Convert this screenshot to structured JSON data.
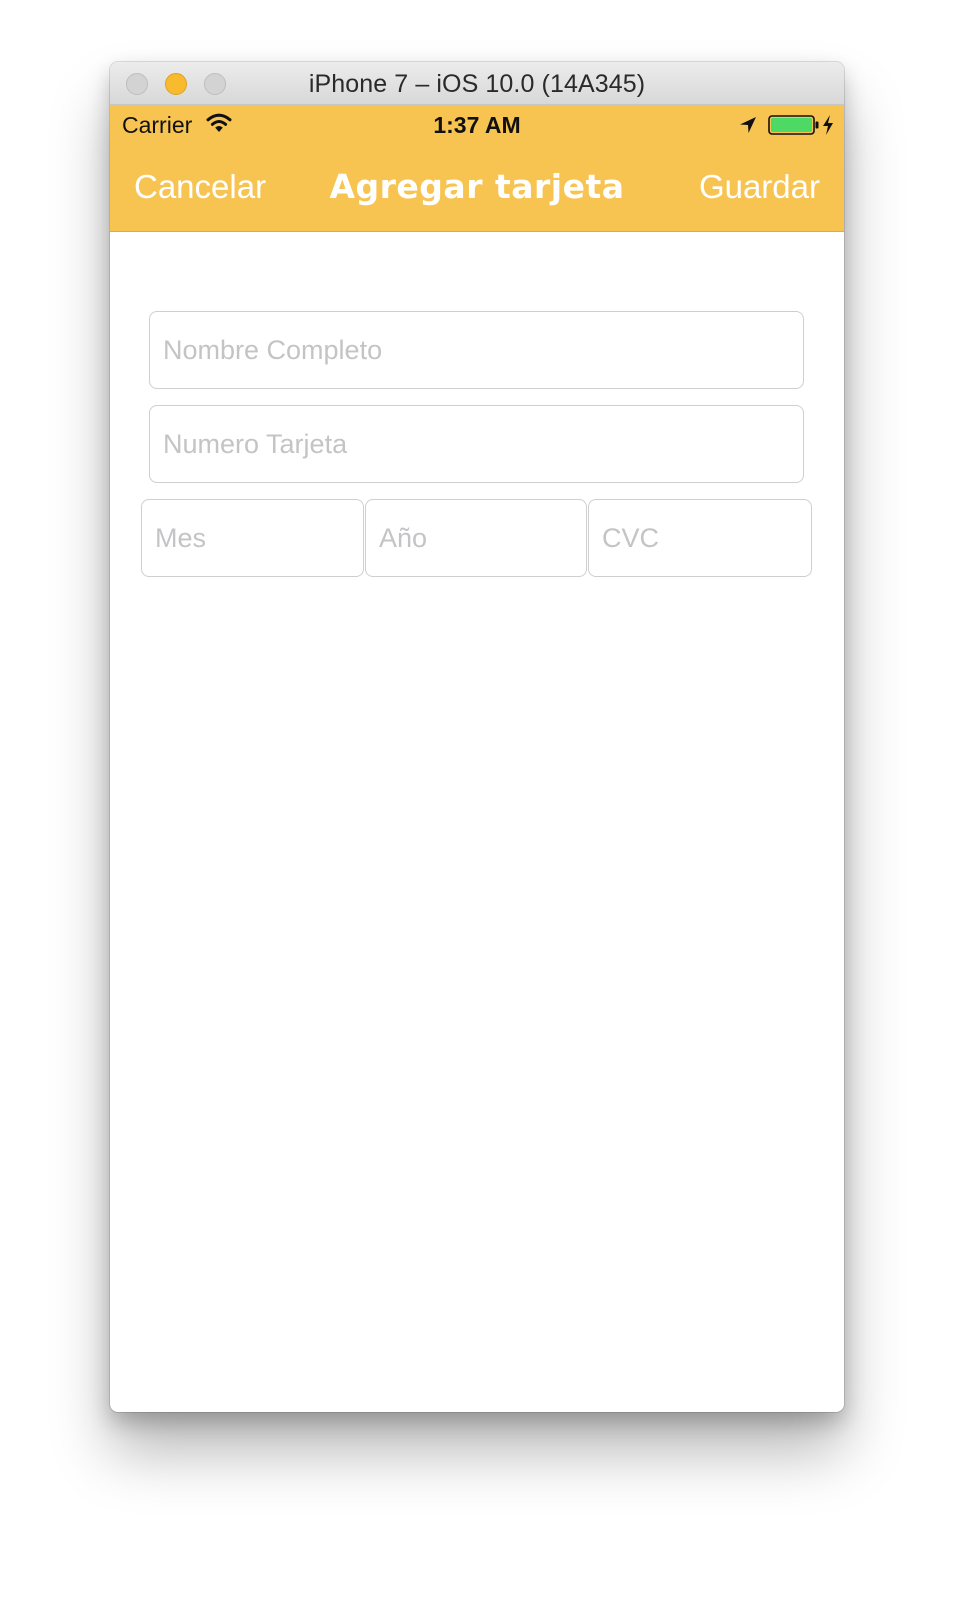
{
  "window": {
    "title": "iPhone 7 – iOS 10.0 (14A345)"
  },
  "status_bar": {
    "carrier": "Carrier",
    "time": "1:37 AM",
    "battery_level": 1.0
  },
  "nav": {
    "cancel_label": "Cancelar",
    "title": "Agregar tarjeta",
    "save_label": "Guardar"
  },
  "form": {
    "full_name": {
      "value": "",
      "placeholder": "Nombre Completo"
    },
    "card_number": {
      "value": "",
      "placeholder": "Numero Tarjeta"
    },
    "month": {
      "value": "",
      "placeholder": "Mes"
    },
    "year": {
      "value": "",
      "placeholder": "Año"
    },
    "cvc": {
      "value": "",
      "placeholder": "CVC"
    }
  },
  "colors": {
    "header": "#f8c451",
    "header_text": "#ffffff",
    "battery_fill": "#4cd964",
    "minimize_button": "#f9bb2e"
  },
  "icons": {
    "wifi": "wifi-icon",
    "location": "location-arrow-icon",
    "battery": "battery-icon",
    "charging": "charging-bolt-icon"
  }
}
